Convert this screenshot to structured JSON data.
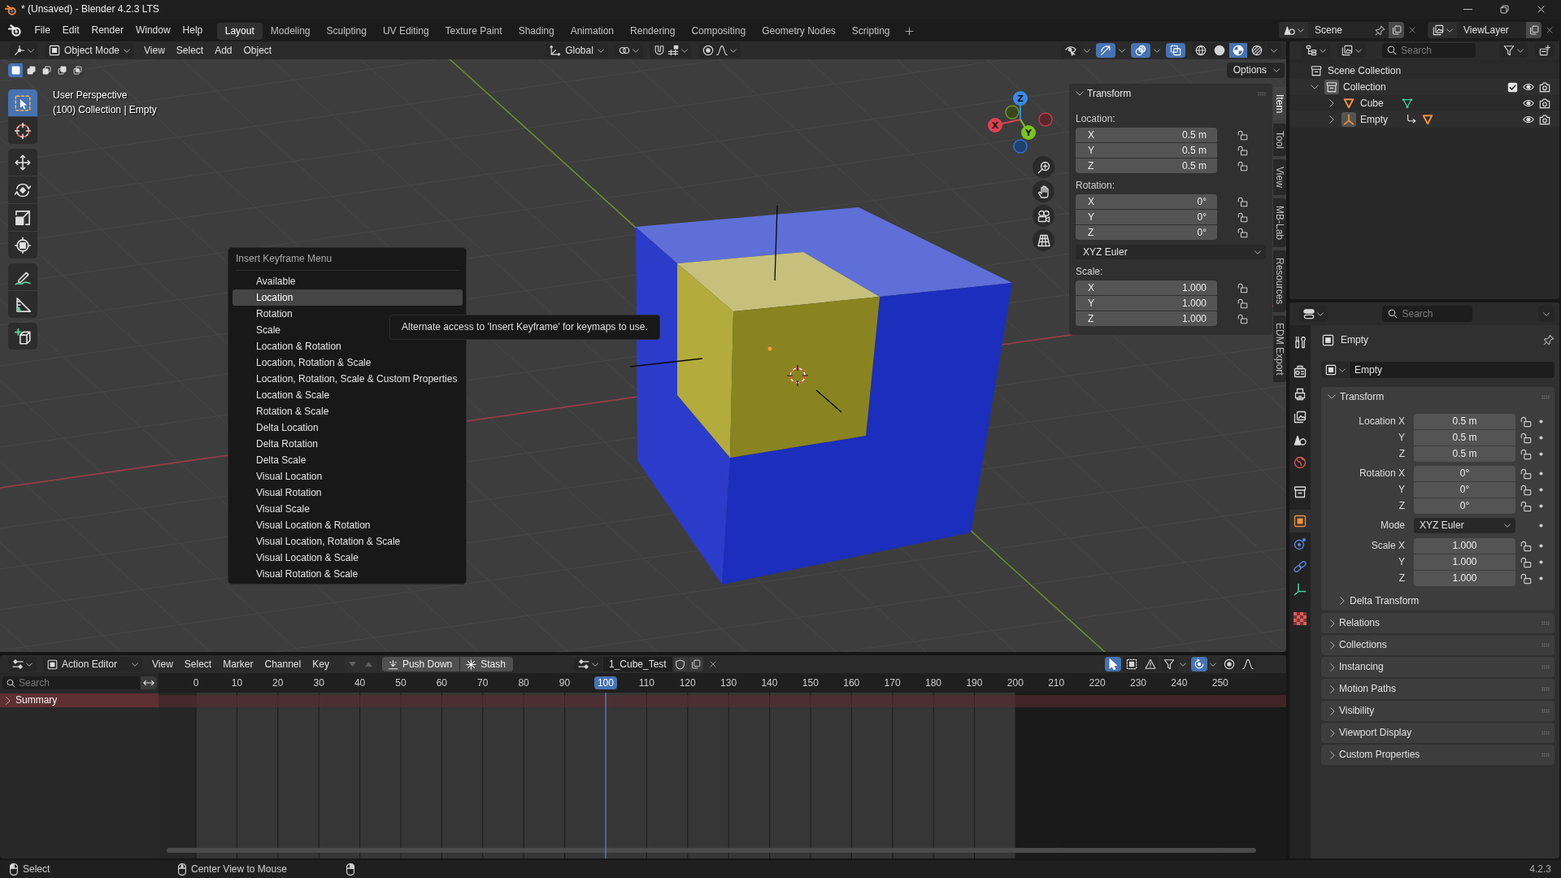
{
  "window": {
    "title": "* (Unsaved) - Blender 4.2.3 LTS"
  },
  "menu_bar": [
    "File",
    "Edit",
    "Render",
    "Window",
    "Help"
  ],
  "workspace_tabs": [
    {
      "label": "Layout",
      "selected": true
    },
    {
      "label": "Modeling",
      "selected": false
    },
    {
      "label": "Sculpting",
      "selected": false
    },
    {
      "label": "UV Editing",
      "selected": false
    },
    {
      "label": "Texture Paint",
      "selected": false
    },
    {
      "label": "Shading",
      "selected": false
    },
    {
      "label": "Animation",
      "selected": false
    },
    {
      "label": "Rendering",
      "selected": false
    },
    {
      "label": "Compositing",
      "selected": false
    },
    {
      "label": "Geometry Nodes",
      "selected": false
    },
    {
      "label": "Scripting",
      "selected": false
    }
  ],
  "scene": {
    "name": "Scene"
  },
  "view_layer": {
    "name": "ViewLayer"
  },
  "viewport": {
    "header": {
      "mode": "Object Mode",
      "menus": [
        "View",
        "Select",
        "Add",
        "Object"
      ],
      "orientation": "Global",
      "toggles": [
        {
          "kind": "visibility",
          "on": false
        },
        {
          "kind": "gizmos",
          "on": true
        },
        {
          "kind": "overlays",
          "on": true
        },
        {
          "kind": "xray",
          "on": true
        }
      ],
      "shading": [
        {
          "kind": "wireframe",
          "selected": false
        },
        {
          "kind": "solid",
          "selected": false
        },
        {
          "kind": "material",
          "selected": true
        },
        {
          "kind": "rendered",
          "selected": false
        }
      ]
    },
    "select_modes": [
      {
        "kind": "set",
        "selected": true
      },
      {
        "kind": "extend",
        "selected": false
      },
      {
        "kind": "subtract",
        "selected": false
      },
      {
        "kind": "invert",
        "selected": false
      },
      {
        "kind": "intersect",
        "selected": false
      }
    ],
    "options": "Options",
    "tool_groups": [
      [
        {
          "kind": "select-box",
          "selected": true
        },
        {
          "kind": "cursor",
          "selected": false
        }
      ],
      [
        {
          "kind": "move",
          "selected": false
        },
        {
          "kind": "rotate",
          "selected": false
        },
        {
          "kind": "scale",
          "selected": false
        },
        {
          "kind": "transform",
          "selected": false
        }
      ],
      [
        {
          "kind": "annotate",
          "selected": false
        },
        {
          "kind": "measure",
          "selected": false
        }
      ],
      [
        {
          "kind": "add-cube",
          "selected": false
        }
      ]
    ],
    "overlay_text": [
      "User Perspective",
      "(100) Collection | Empty"
    ],
    "gizmo": {
      "x": "X",
      "y": "Y",
      "z": "Z"
    },
    "sidebar": {
      "tabs": [
        {
          "label": "Item",
          "selected": true
        },
        {
          "label": "Tool",
          "selected": false
        },
        {
          "label": "View",
          "selected": false
        },
        {
          "label": "MB-Lab",
          "selected": false
        },
        {
          "label": "Resources",
          "selected": false
        },
        {
          "label": "EDM Export",
          "selected": false
        }
      ],
      "panel": {
        "title": "Transform",
        "expanded": true,
        "sections": [
          {
            "kind": "vector",
            "label": "Location:",
            "fields": [
              {
                "axis": "X",
                "value": "0.5 m",
                "locked": false
              },
              {
                "axis": "Y",
                "value": "0.5 m",
                "locked": false
              },
              {
                "axis": "Z",
                "value": "0.5 m",
                "locked": false
              }
            ]
          },
          {
            "kind": "vector",
            "label": "Rotation:",
            "fields": [
              {
                "axis": "X",
                "value": "0°",
                "locked": false
              },
              {
                "axis": "Y",
                "value": "0°",
                "locked": false
              },
              {
                "axis": "Z",
                "value": "0°",
                "locked": false
              }
            ]
          },
          {
            "kind": "dropdown",
            "value": "XYZ Euler"
          },
          {
            "kind": "vector",
            "label": "Scale:",
            "fields": [
              {
                "axis": "X",
                "value": "1.000",
                "locked": false
              },
              {
                "axis": "Y",
                "value": "1.000",
                "locked": false
              },
              {
                "axis": "Z",
                "value": "1.000",
                "locked": false
              }
            ]
          }
        ]
      }
    },
    "keyframe_menu": {
      "title": "Insert Keyframe Menu",
      "items": [
        {
          "label": "Available",
          "selected": false
        },
        {
          "label": "Location",
          "selected": true
        },
        {
          "label": "Rotation",
          "selected": false
        },
        {
          "label": "Scale",
          "selected": false
        },
        {
          "label": "Location & Rotation",
          "selected": false
        },
        {
          "label": "Location, Rotation & Scale",
          "selected": false
        },
        {
          "label": "Location, Rotation, Scale & Custom Properties",
          "selected": false
        },
        {
          "label": "Location & Scale",
          "selected": false
        },
        {
          "label": "Rotation & Scale",
          "selected": false
        },
        {
          "label": "Delta Location",
          "selected": false
        },
        {
          "label": "Delta Rotation",
          "selected": false
        },
        {
          "label": "Delta Scale",
          "selected": false
        },
        {
          "label": "Visual Location",
          "selected": false
        },
        {
          "label": "Visual Rotation",
          "selected": false
        },
        {
          "label": "Visual Scale",
          "selected": false
        },
        {
          "label": "Visual Location & Rotation",
          "selected": false
        },
        {
          "label": "Visual Location, Rotation & Scale",
          "selected": false
        },
        {
          "label": "Visual Location & Scale",
          "selected": false
        },
        {
          "label": "Visual Rotation & Scale",
          "selected": false
        }
      ]
    },
    "tooltip": "Alternate access to 'Insert Keyframe' for keymaps to use."
  },
  "outliner": {
    "search_placeholder": "Search",
    "tree": [
      {
        "label": "Scene Collection",
        "kind": "collection",
        "active": false,
        "children": [
          {
            "label": "Collection",
            "kind": "collection",
            "active": true,
            "expanded": true,
            "checked": true,
            "visible": true,
            "renderable": true,
            "children": [
              {
                "label": "Cube",
                "kind": "mesh",
                "active": false,
                "expanded": false,
                "visible": true,
                "renderable": true,
                "badges": [
                  {
                    "kind": "mesh-data"
                  }
                ]
              },
              {
                "label": "Empty",
                "kind": "empty",
                "active": true,
                "expanded": false,
                "visible": true,
                "renderable": true,
                "badges": [
                  {
                    "kind": "child"
                  },
                  {
                    "kind": "mesh"
                  }
                ]
              }
            ]
          }
        ]
      }
    ]
  },
  "properties": {
    "search_placeholder": "Search",
    "tabs": [
      [
        {
          "kind": "tool",
          "selected": false
        }
      ],
      [
        {
          "kind": "render",
          "selected": false
        },
        {
          "kind": "output",
          "selected": false
        },
        {
          "kind": "view-layer",
          "selected": false
        },
        {
          "kind": "scene",
          "selected": false
        },
        {
          "kind": "world",
          "selected": false
        }
      ],
      [
        {
          "kind": "collection",
          "selected": false
        }
      ],
      [
        {
          "kind": "object",
          "selected": true
        },
        {
          "kind": "physics",
          "selected": false
        },
        {
          "kind": "constraints",
          "selected": false
        },
        {
          "kind": "data",
          "selected": false
        }
      ],
      [
        {
          "kind": "texture",
          "selected": false
        }
      ]
    ],
    "object_name": "Empty",
    "datablock": "Empty",
    "transform": {
      "title": "Transform",
      "expanded": true,
      "groups": [
        {
          "rows": [
            {
              "kind": "number",
              "label": "Location X",
              "value": "0.5 m",
              "locked": false
            },
            {
              "kind": "number",
              "label": "Y",
              "value": "0.5 m",
              "locked": false
            },
            {
              "kind": "number",
              "label": "Z",
              "value": "0.5 m",
              "locked": false
            }
          ]
        },
        {
          "rows": [
            {
              "kind": "number",
              "label": "Rotation X",
              "value": "0°",
              "locked": false
            },
            {
              "kind": "number",
              "label": "Y",
              "value": "0°",
              "locked": false
            },
            {
              "kind": "number",
              "label": "Z",
              "value": "0°",
              "locked": false
            }
          ]
        },
        {
          "rows": [
            {
              "kind": "dropdown",
              "label": "Mode",
              "value": "XYZ Euler"
            }
          ]
        },
        {
          "rows": [
            {
              "kind": "number",
              "label": "Scale X",
              "value": "1.000",
              "locked": false
            },
            {
              "kind": "number",
              "label": "Y",
              "value": "1.000",
              "locked": false
            },
            {
              "kind": "number",
              "label": "Z",
              "value": "1.000",
              "locked": false
            }
          ]
        }
      ],
      "subpanel": {
        "label": "Delta Transform",
        "expanded": false
      }
    },
    "panels": [
      {
        "label": "Relations",
        "expanded": false
      },
      {
        "label": "Collections",
        "expanded": false
      },
      {
        "label": "Instancing",
        "expanded": false
      },
      {
        "label": "Motion Paths",
        "expanded": false
      },
      {
        "label": "Visibility",
        "expanded": false
      },
      {
        "label": "Viewport Display",
        "expanded": false
      },
      {
        "label": "Custom Properties",
        "expanded": false
      }
    ]
  },
  "action_editor": {
    "editor": "Action Editor",
    "menus": [
      "View",
      "Select",
      "Marker",
      "Channel",
      "Key"
    ],
    "layer_buttons": [
      {
        "kind": "down",
        "disabled": true
      },
      {
        "kind": "up",
        "disabled": true
      }
    ],
    "buttons": [
      {
        "kind": "push-down",
        "label": "Push Down"
      },
      {
        "kind": "stash",
        "label": "Stash"
      }
    ],
    "action": "1_Cube_Test",
    "toggles": [
      {
        "kind": "only-selected",
        "on": true
      },
      {
        "kind": "hidden",
        "on": false
      },
      {
        "kind": "errors",
        "on": false
      },
      {
        "kind": "filter",
        "on": false
      },
      {
        "kind": "snap",
        "on": true
      },
      {
        "kind": "proportional",
        "on": false
      }
    ],
    "search_placeholder": "Search",
    "ruler": [
      {
        "label": "0",
        "selected": false,
        "in_range": true
      },
      {
        "label": "10",
        "selected": false,
        "in_range": true
      },
      {
        "label": "20",
        "selected": false,
        "in_range": true
      },
      {
        "label": "30",
        "selected": false,
        "in_range": true
      },
      {
        "label": "40",
        "selected": false,
        "in_range": true
      },
      {
        "label": "50",
        "selected": false,
        "in_range": true
      },
      {
        "label": "60",
        "selected": false,
        "in_range": true
      },
      {
        "label": "70",
        "selected": false,
        "in_range": true
      },
      {
        "label": "80",
        "selected": false,
        "in_range": true
      },
      {
        "label": "90",
        "selected": false,
        "in_range": true
      },
      {
        "label": "100",
        "selected": true,
        "in_range": true
      },
      {
        "label": "110",
        "selected": false,
        "in_range": true
      },
      {
        "label": "120",
        "selected": false,
        "in_range": true
      },
      {
        "label": "130",
        "selected": false,
        "in_range": true
      },
      {
        "label": "140",
        "selected": false,
        "in_range": true
      },
      {
        "label": "150",
        "selected": false,
        "in_range": true
      },
      {
        "label": "160",
        "selected": false,
        "in_range": true
      },
      {
        "label": "170",
        "selected": false,
        "in_range": true
      },
      {
        "label": "180",
        "selected": false,
        "in_range": true
      },
      {
        "label": "190",
        "selected": false,
        "in_range": true
      },
      {
        "label": "200",
        "selected": false,
        "in_range": false
      },
      {
        "label": "210",
        "selected": false,
        "in_range": false
      },
      {
        "label": "220",
        "selected": false,
        "in_range": false
      },
      {
        "label": "230",
        "selected": false,
        "in_range": false
      },
      {
        "label": "240",
        "selected": false,
        "in_range": false
      },
      {
        "label": "250",
        "selected": false,
        "in_range": false
      }
    ],
    "channels": [
      {
        "label": "Summary",
        "expanded": false
      }
    ]
  },
  "status_bar": {
    "items": [
      {
        "kind": "mouse-left",
        "label": "Select"
      },
      {
        "kind": "mouse-middle",
        "label": "Center View to Mouse"
      },
      {
        "kind": "mouse-right"
      }
    ],
    "version": "4.2.3"
  }
}
